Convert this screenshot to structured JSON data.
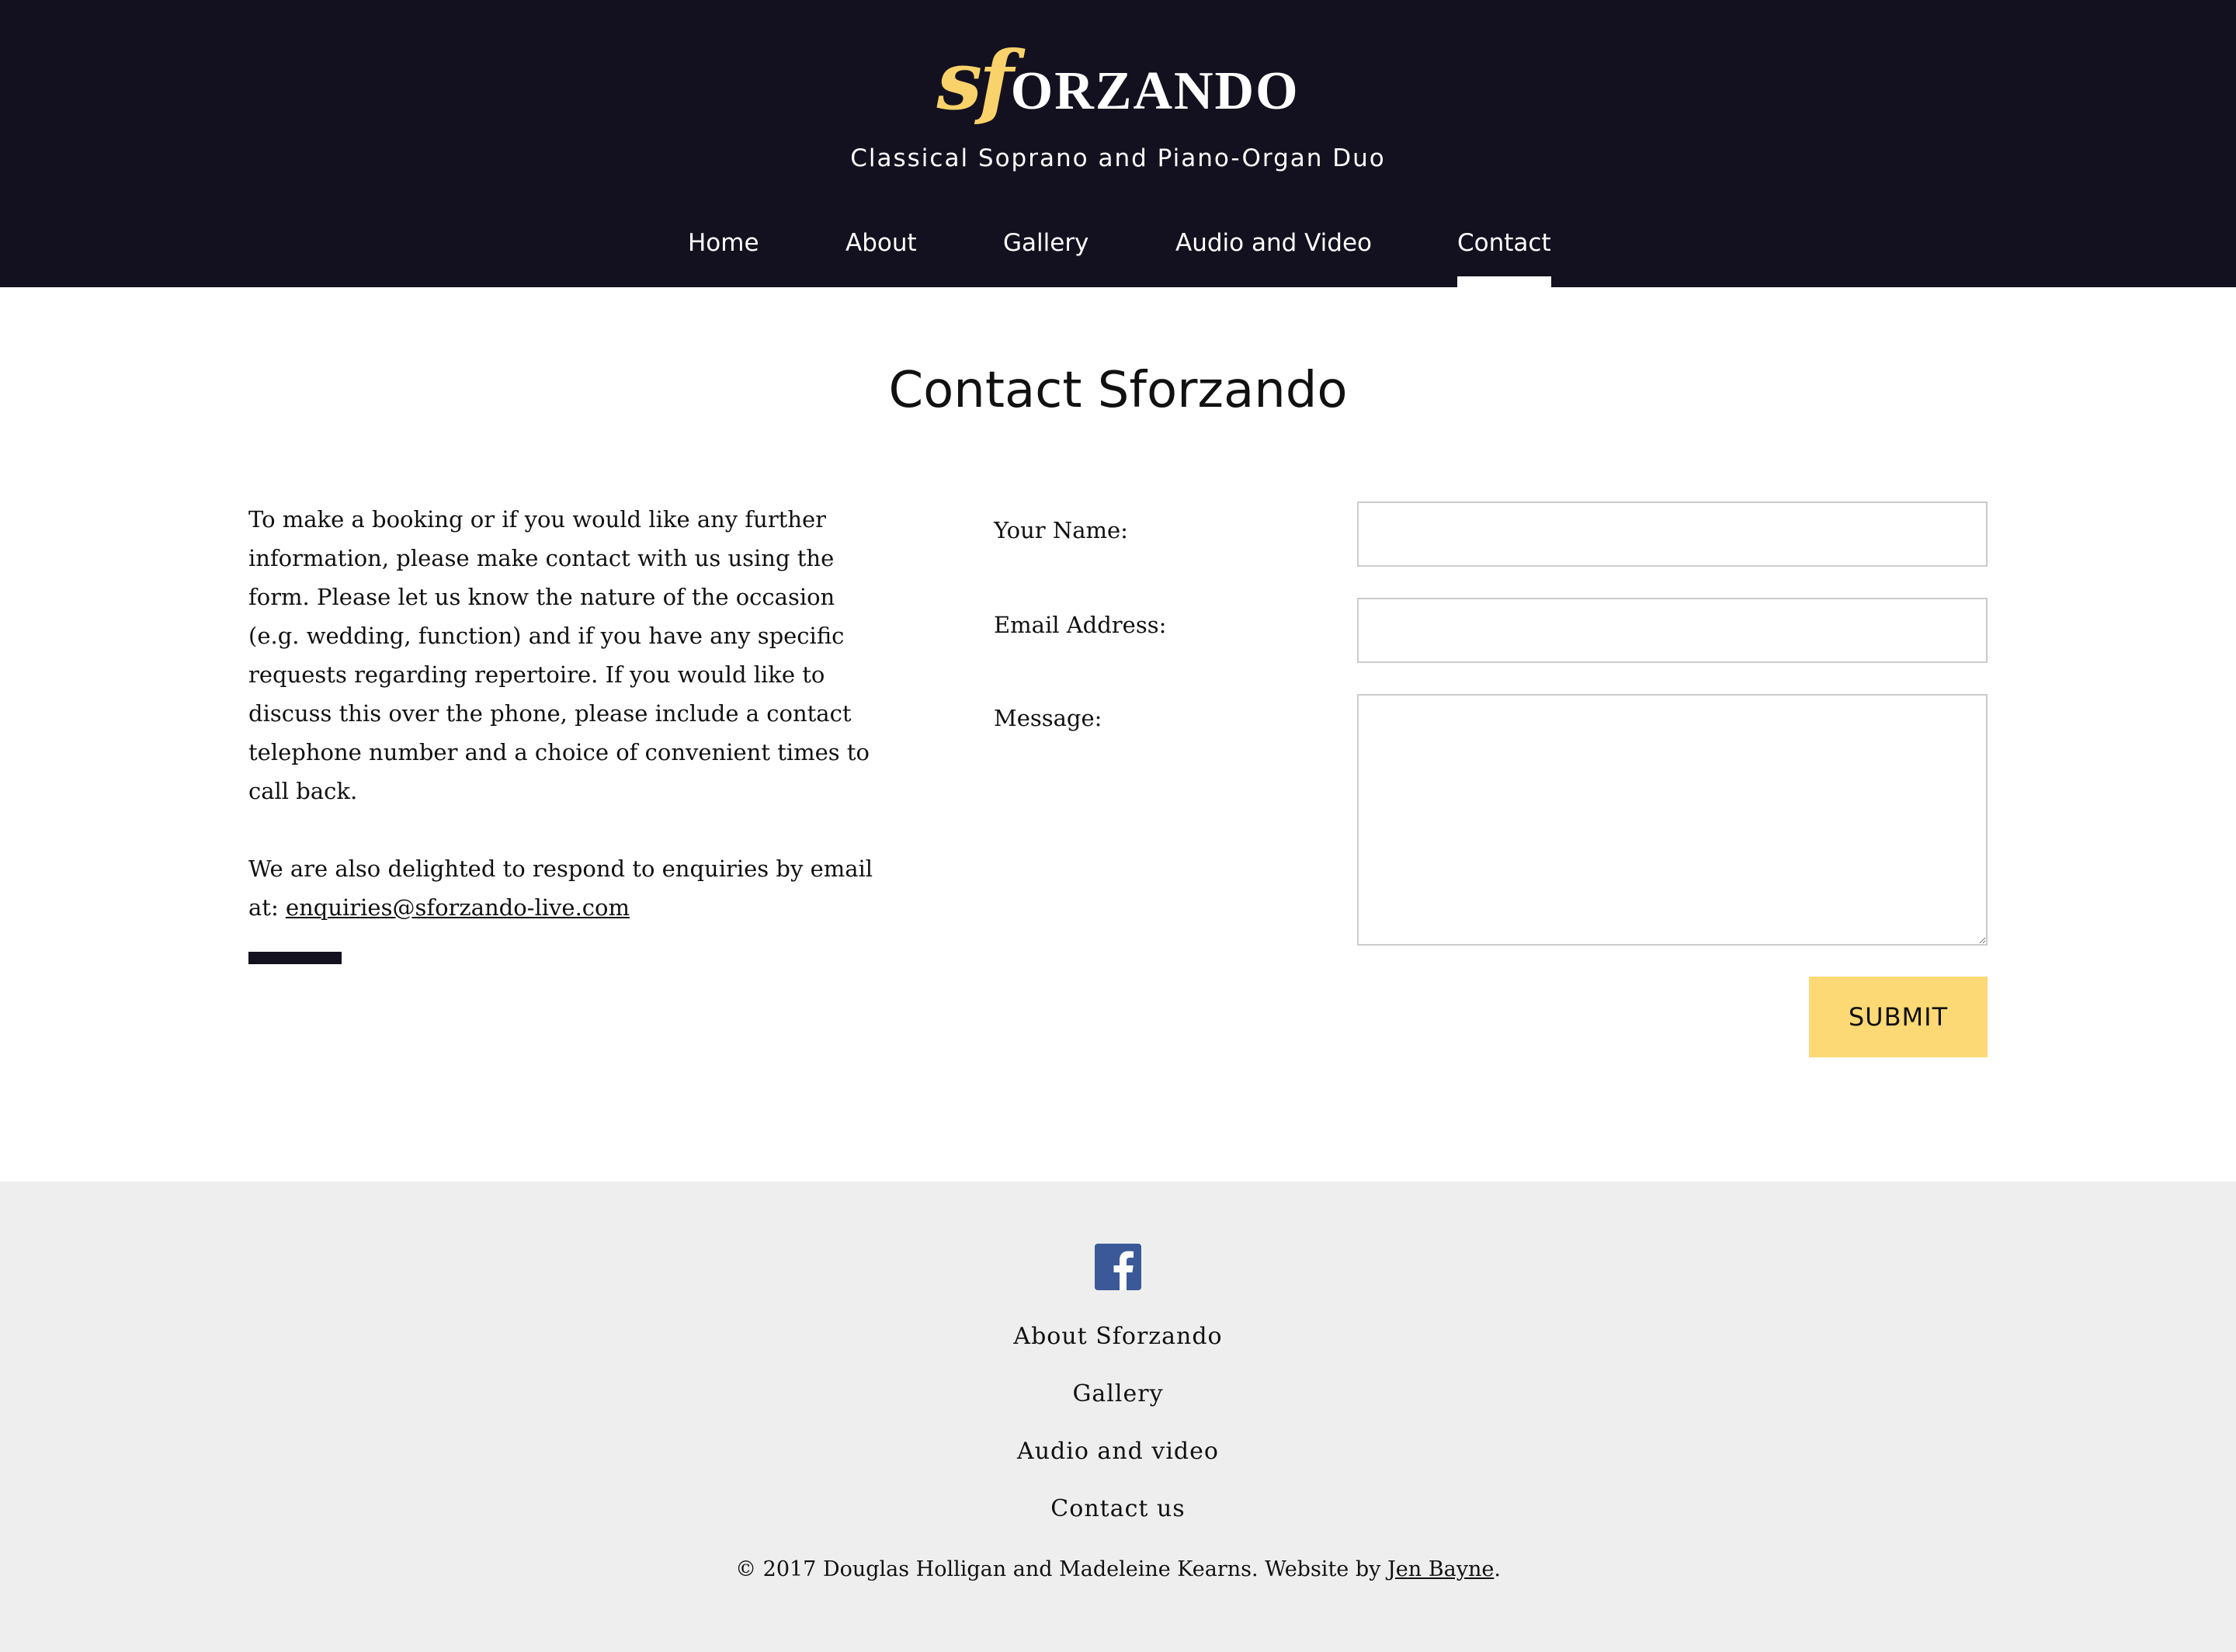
{
  "header": {
    "logo_sf": "sf",
    "logo_rest": "ORZANDO",
    "tagline": "Classical Soprano and Piano-Organ Duo",
    "nav": {
      "home": "Home",
      "about": "About",
      "gallery": "Gallery",
      "audio_video": "Audio and Video",
      "contact": "Contact"
    },
    "active_nav": "Contact"
  },
  "main": {
    "title": "Contact Sforzando",
    "intro_paragraph": "To make a booking or if you would like any further information, please make contact with us using the form. Please let us know the nature of the occasion (e.g. wedding, function) and if you have any specific requests regarding repertoire. If you would like to discuss this over the phone, please include a contact telephone number and a choice of convenient times to call back.",
    "email_prefix": "We are also delighted to respond to enquiries by email at: ",
    "email": "enquiries@sforzando-live.com"
  },
  "form": {
    "name_label": "Your Name:",
    "name_value": "",
    "email_label": "Email Address:",
    "email_value": "",
    "message_label": "Message:",
    "message_value": "",
    "submit_label": "SUBMIT"
  },
  "footer": {
    "facebook_icon": "facebook-icon",
    "links": {
      "about": "About Sforzando",
      "gallery": "Gallery",
      "audio_video": "Audio and video",
      "contact": "Contact us"
    },
    "copyright_text": "© 2017 Douglas Holligan and Madeleine Kearns. Website by ",
    "credit_link": "Jen Bayne",
    "copyright_end": "."
  },
  "colors": {
    "header_bg": "#13111f",
    "accent_gold": "#f9d26b",
    "submit_bg": "#fcd974",
    "footer_bg": "#eeeeee",
    "facebook_blue": "#3b5998"
  }
}
